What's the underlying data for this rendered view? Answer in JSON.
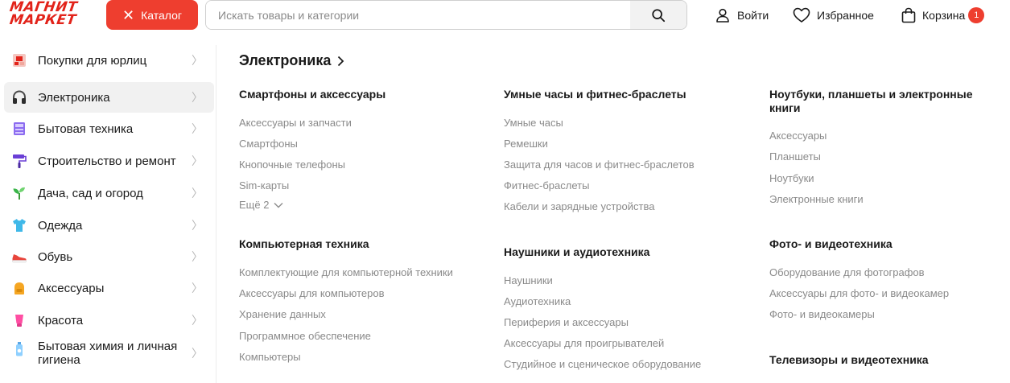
{
  "header": {
    "logo_line1": "МАГНИТ",
    "logo_line2": "МАРКЕТ",
    "catalog_label": "Каталог",
    "search_placeholder": "Искать товары и категории",
    "login_label": "Войти",
    "favorites_label": "Избранное",
    "cart_label": "Корзина",
    "cart_count": "1"
  },
  "sidebar": {
    "items": [
      {
        "label": "Покупки для юрлиц",
        "icon": "business-icon"
      },
      {
        "label": "Электроника",
        "icon": "headphones-icon"
      },
      {
        "label": "Бытовая техника",
        "icon": "appliance-icon"
      },
      {
        "label": "Строительство и ремонт",
        "icon": "paint-roller-icon"
      },
      {
        "label": "Дача, сад и огород",
        "icon": "sprout-icon"
      },
      {
        "label": "Одежда",
        "icon": "tshirt-icon"
      },
      {
        "label": "Обувь",
        "icon": "sneaker-icon"
      },
      {
        "label": "Аксессуары",
        "icon": "backpack-icon"
      },
      {
        "label": "Красота",
        "icon": "cosmetics-icon"
      },
      {
        "label": "Бытовая химия и личная гигиена",
        "icon": "detergent-icon"
      }
    ]
  },
  "main": {
    "title": "Электроника",
    "groups": [
      {
        "title": "Смартфоны и аксессуары",
        "links": [
          "Аксессуары и запчасти",
          "Смартфоны",
          "Кнопочные телефоны",
          "Sim-карты"
        ],
        "more": "Ещё 2"
      },
      {
        "title": "Компьютерная техника",
        "links": [
          "Комплектующие для компьютерной техники",
          "Аксессуары для компьютеров",
          "Хранение данных",
          "Программное обеспечение",
          "Компьютеры"
        ]
      },
      {
        "title": "Умные часы и фитнес-браслеты",
        "links": [
          "Умные часы",
          "Ремешки",
          "Защита для часов и фитнес-браслетов",
          "Фитнес-браслеты",
          "Кабели и зарядные устройства"
        ]
      },
      {
        "title": "Наушники и аудиотехника",
        "links": [
          "Наушники",
          "Аудиотехника",
          "Периферия и аксессуары",
          "Аксессуары для проигрывателей",
          "Студийное и сценическое оборудование"
        ]
      },
      {
        "title_line1": "Ноутбуки, планшеты и электронные",
        "title_line2": "книги",
        "links": [
          "Аксессуары",
          "Планшеты",
          "Ноутбуки",
          "Электронные книги"
        ]
      },
      {
        "title": "Фото- и видеотехника",
        "links": [
          "Оборудование для фотографов",
          "Аксессуары для фото- и видеокамер",
          "Фото- и видеокамеры"
        ]
      },
      {
        "title": "Телевизоры и видеотехника"
      }
    ]
  },
  "colors": {
    "brand_red": "#ee3e2f",
    "muted": "#8a8a8a"
  }
}
